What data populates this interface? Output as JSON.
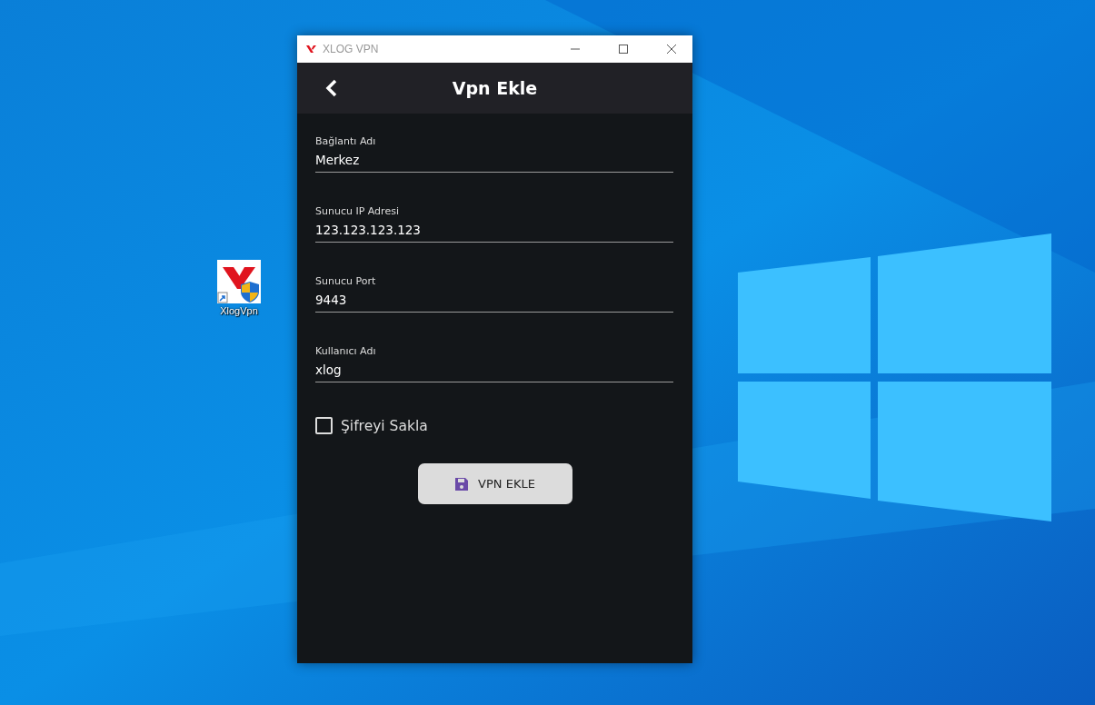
{
  "desktop_icon": {
    "label": "XlogVpn"
  },
  "window": {
    "title": "XLOG VPN"
  },
  "header": {
    "title": "Vpn Ekle"
  },
  "fields": [
    {
      "label": "Bağlantı Adı",
      "value": "Merkez"
    },
    {
      "label": "Sunucu IP Adresi",
      "value": "123.123.123.123"
    },
    {
      "label": "Sunucu Port",
      "value": "9443"
    },
    {
      "label": "Kullanıcı Adı",
      "value": "xlog"
    }
  ],
  "save_password": {
    "label": "Şifreyi Sakla",
    "checked": false
  },
  "submit_button": {
    "label": "VPN EKLE"
  }
}
